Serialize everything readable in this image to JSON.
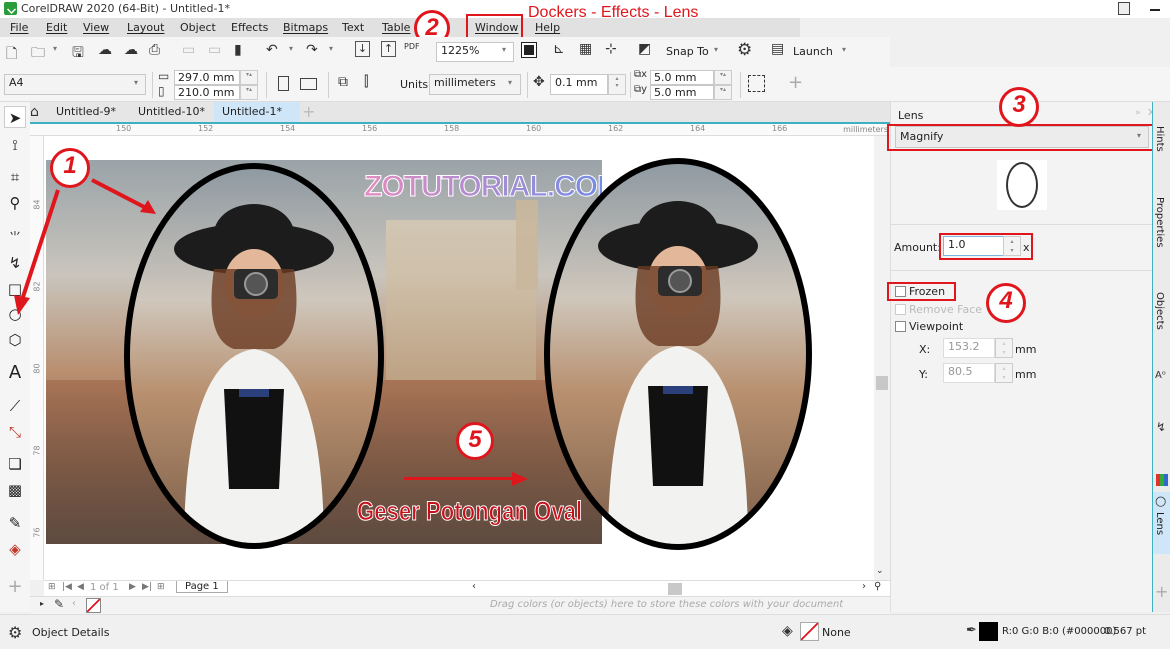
{
  "window": {
    "title": "CorelDRAW 2020 (64-Bit) - Untitled-1*"
  },
  "menu": [
    "File",
    "Edit",
    "View",
    "Layout",
    "Object",
    "Effects",
    "Bitmaps",
    "Text",
    "Table",
    "Window",
    "Help"
  ],
  "annotations": {
    "path_label": "Dockers - Effects - Lens",
    "step1": "1",
    "step2": "2",
    "step3": "3",
    "step4": "4",
    "step5": "5",
    "canvas_caption": "Geser Potongan Oval",
    "watermark": "ZOTUTORIAL.COM",
    "accent_color": "#e0161d"
  },
  "toolbar": {
    "zoom": "1225%",
    "snap_to": "Snap To",
    "launch": "Launch"
  },
  "property_bar": {
    "page_size": "A4",
    "width": "297.0 mm",
    "height": "210.0 mm",
    "units_label": "Units:",
    "units": "millimeters",
    "nudge": "0.1 mm",
    "dup_x": "5.0 mm",
    "dup_y": "5.0 mm"
  },
  "tabs": [
    {
      "label": "Untitled-9*"
    },
    {
      "label": "Untitled-10*"
    },
    {
      "label": "Untitled-1*",
      "active": true
    }
  ],
  "ruler": {
    "h_ticks": [
      "150",
      "152",
      "154",
      "156",
      "158",
      "160",
      "162",
      "164",
      "166"
    ],
    "unit": "millimeters",
    "v_ticks": [
      "84",
      "82",
      "80",
      "78",
      "76"
    ]
  },
  "page_nav": {
    "counter": "1 of 1",
    "page_tab": "Page 1"
  },
  "palette_hint": "Drag colors (or objects) here to store these colors with your document",
  "docker": {
    "title": "Lens",
    "lens_type": "Magnify",
    "amount_label": "Amount:",
    "amount": "1.0",
    "amount_unit": "x",
    "frozen": "Frozen",
    "remove_face": "Remove Face",
    "viewpoint": "Viewpoint",
    "x_label": "X:",
    "x_value": "153.2",
    "y_label": "Y:",
    "y_value": "80.5",
    "unit": "mm"
  },
  "docker_tabs": [
    "Hints",
    "Properties",
    "Objects",
    "Lens"
  ],
  "status": {
    "object_details": "Object Details",
    "fill": "None",
    "outline": "R:0 G:0 B:0 (#000000)",
    "outline_width": "0.567 pt"
  }
}
